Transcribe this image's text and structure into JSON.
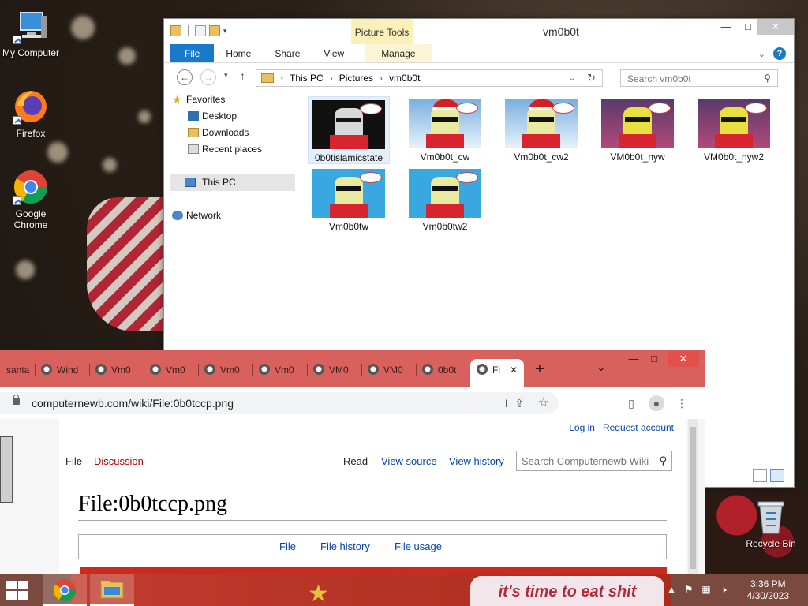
{
  "desktop": {
    "icons": [
      {
        "label": "My Computer"
      },
      {
        "label": "Firefox"
      },
      {
        "label": "Google Chrome"
      },
      {
        "label": "Recycle Bin"
      }
    ]
  },
  "explorer": {
    "title": "vm0b0t",
    "contextual_tab": "Picture Tools",
    "ribbon_tabs": [
      "File",
      "Home",
      "Share",
      "View",
      "Manage"
    ],
    "address": {
      "segments": [
        "This PC",
        "Pictures",
        "vm0b0t"
      ]
    },
    "search_placeholder": "Search vm0b0t",
    "nav": {
      "favorites": "Favorites",
      "favorites_items": [
        "Desktop",
        "Downloads",
        "Recent places"
      ],
      "this_pc": "This PC",
      "network": "Network"
    },
    "files": [
      {
        "name": "0b0tislamicstate",
        "selected": true
      },
      {
        "name": "Vm0b0t_cw"
      },
      {
        "name": "Vm0b0t_cw2"
      },
      {
        "name": "VM0b0t_nyw"
      },
      {
        "name": "VM0b0t_nyw2"
      },
      {
        "name": "Vm0b0tw"
      },
      {
        "name": "Vm0b0tw2"
      }
    ]
  },
  "browser": {
    "tabs": [
      "santa",
      "Wind",
      "Vm0",
      "Vm0",
      "Vm0",
      "Vm0",
      "VM0",
      "VM0",
      "0b0t",
      "Fi"
    ],
    "url": "computernewb.com/wiki/File:0b0tccp.png",
    "page": {
      "login": "Log in",
      "request_account": "Request account",
      "tab_file": "File",
      "tab_discussion": "Discussion",
      "tab_read": "Read",
      "tab_view_source": "View source",
      "tab_view_history": "View history",
      "search_placeholder": "Search Computernewb Wiki",
      "title": "File:0b0tccp.png",
      "file_tabs": [
        "File",
        "File history",
        "File usage"
      ]
    }
  },
  "taskbar": {
    "banner_text": "it's time to eat shit",
    "time": "3:36 PM",
    "date": "4/30/2023"
  },
  "colors": {
    "ribbon_file": "#1979ca",
    "chrome_frame": "#d8615e",
    "link": "#0645ad"
  }
}
